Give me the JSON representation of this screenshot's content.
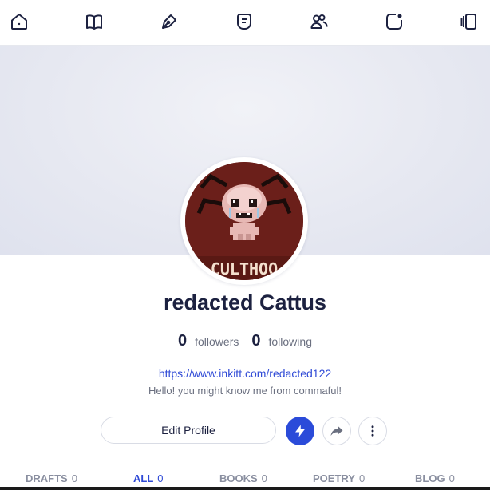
{
  "nav": {
    "items": [
      {
        "icon": "home-icon"
      },
      {
        "icon": "book-icon"
      },
      {
        "icon": "write-icon"
      },
      {
        "icon": "groups-icon"
      },
      {
        "icon": "people-icon"
      },
      {
        "icon": "notifications-icon"
      },
      {
        "icon": "library-icon"
      }
    ]
  },
  "profile": {
    "name": "redacted Cattus",
    "followers_count": "0",
    "followers_label": "followers",
    "following_count": "0",
    "following_label": "following",
    "link": "https://www.inkitt.com/redacted122",
    "bio": "Hello! you might know me from commaful!",
    "avatar_caption": "CULTHOO"
  },
  "actions": {
    "edit_label": "Edit Profile",
    "boost_icon": "lightning-icon",
    "share_icon": "share-icon",
    "more_icon": "more-vertical-icon"
  },
  "tabs": [
    {
      "label": "DRAFTS",
      "count": "0",
      "active": false
    },
    {
      "label": "ALL",
      "count": "0",
      "active": true
    },
    {
      "label": "BOOKS",
      "count": "0",
      "active": false
    },
    {
      "label": "POETRY",
      "count": "0",
      "active": false
    },
    {
      "label": "BLOG",
      "count": "0",
      "active": false
    }
  ],
  "colors": {
    "accent": "#2b4bd9",
    "text_dark": "#1c2140",
    "text_muted": "#6b7080"
  }
}
